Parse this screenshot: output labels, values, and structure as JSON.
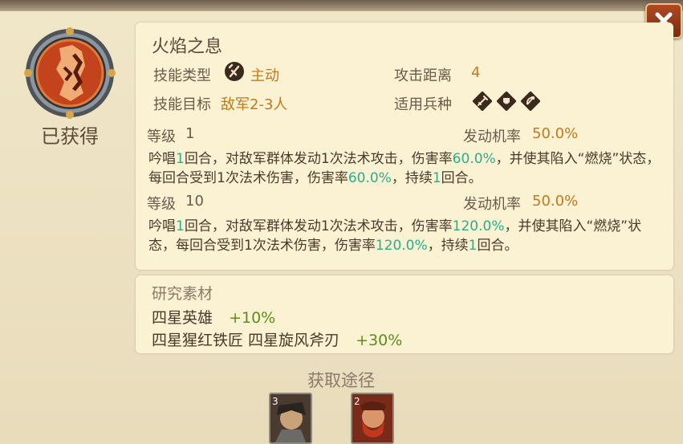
{
  "skill": {
    "name": "火焰之息",
    "status": "已获得",
    "type_label": "技能类型",
    "type_value": "主动",
    "type_icon": "active-skill-icon",
    "range_label": "攻击距离",
    "range_value": "4",
    "target_label": "技能目标",
    "target_value": "敌军2-3人",
    "units_label": "适用兵种",
    "units": [
      "sword-icon",
      "shield-icon",
      "bow-icon"
    ]
  },
  "levels": [
    {
      "level_label": "等级",
      "level_value": "1",
      "rate_label": "发动机率",
      "rate_value": "50.0%",
      "desc": [
        {
          "text": "吟唱"
        },
        {
          "text": "1",
          "hl": "green"
        },
        {
          "text": "回合，对敌军群体发动1次法术攻击，伤害率"
        },
        {
          "text": "60.0%",
          "hl": "green"
        },
        {
          "text": "，并使其陷入“燃烧”状态，每回合受到1次法术伤害，伤害率"
        },
        {
          "text": "60.0%",
          "hl": "green"
        },
        {
          "text": "，持续"
        },
        {
          "text": "1",
          "hl": "green"
        },
        {
          "text": "回合。"
        }
      ]
    },
    {
      "level_label": "等级",
      "level_value": "10",
      "rate_label": "发动机率",
      "rate_value": "50.0%",
      "desc": [
        {
          "text": "吟唱"
        },
        {
          "text": "1",
          "hl": "green"
        },
        {
          "text": "回合，对敌军群体发动1次法术攻击，伤害率"
        },
        {
          "text": "120.0%",
          "hl": "green"
        },
        {
          "text": "，并使其陷入“燃烧”状态，每回合受到1次法术伤害，伤害率"
        },
        {
          "text": "120.0%",
          "hl": "green"
        },
        {
          "text": "，持续"
        },
        {
          "text": "1",
          "hl": "green"
        },
        {
          "text": "回合。"
        }
      ]
    }
  ],
  "materials": {
    "title": "研究素材",
    "rows": [
      {
        "names": "四星英雄",
        "bonus": "+10%"
      },
      {
        "names": "四星猩红铁匠 四星旋风斧刃",
        "bonus": "+30%"
      }
    ]
  },
  "source": {
    "title": "获取途径",
    "heroes": [
      {
        "badge": "3",
        "color": "#6b4a3a"
      },
      {
        "badge": "2",
        "color": "#a0301a"
      }
    ]
  },
  "colors": {
    "gold": "#c07a1a",
    "green": "#27b089",
    "olive": "#5e8c1b",
    "close_bg": "#9a3a18"
  }
}
